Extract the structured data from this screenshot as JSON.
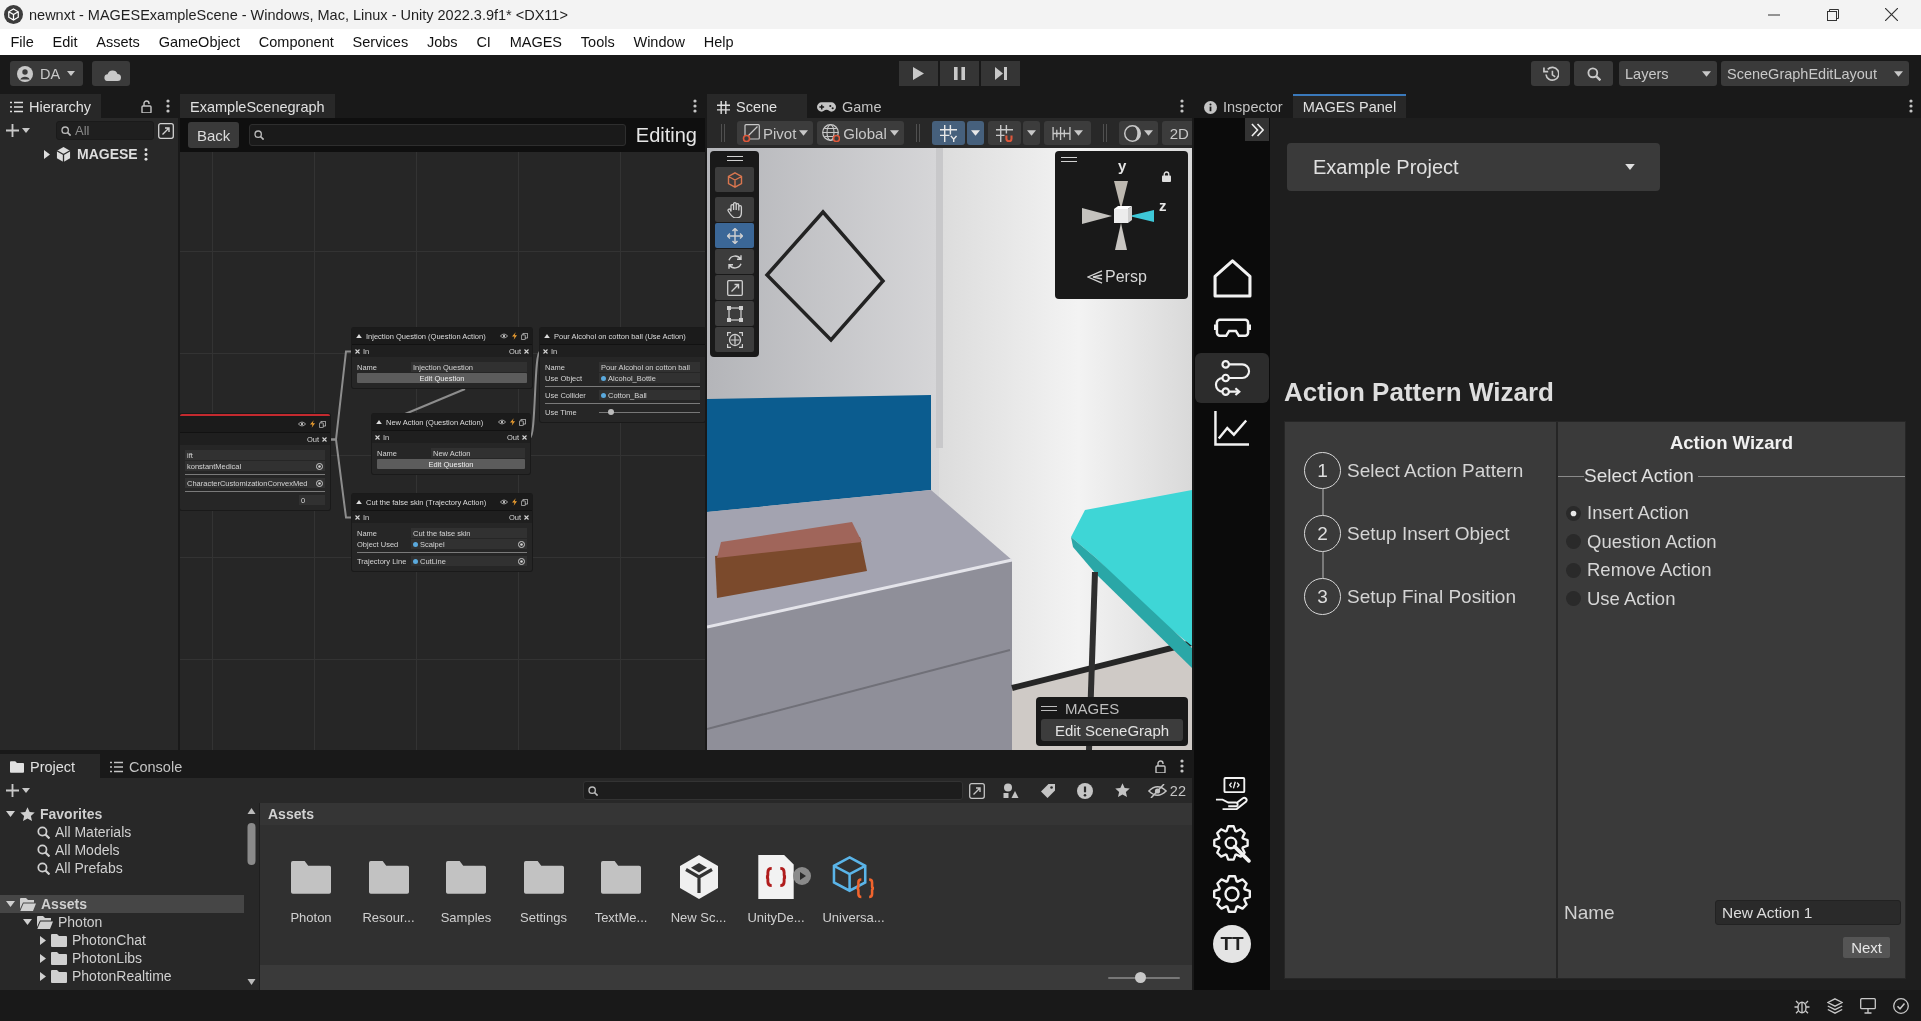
{
  "window": {
    "title": "newnxt - MAGESExampleScene - Windows, Mac, Linux - Unity 2022.3.9f1* <DX11>"
  },
  "menu": [
    "File",
    "Edit",
    "Assets",
    "GameObject",
    "Component",
    "Services",
    "Jobs",
    "CI",
    "MAGES",
    "Tools",
    "Window",
    "Help"
  ],
  "toolbar": {
    "account": "DA",
    "layers": "Layers",
    "layout": "SceneGraphEditLayout"
  },
  "hierarchy": {
    "tab": "Hierarchy",
    "search": {
      "placeholder": "All"
    },
    "items": [
      {
        "label": "MAGESE",
        "expanded": false
      }
    ]
  },
  "graph": {
    "tab": "ExampleScenegraph",
    "back": "Back",
    "status": "Editing",
    "nodes": [
      {
        "title": "Injection Question (Question Action)",
        "active": false,
        "in": "In",
        "out": "Out",
        "fields": [
          {
            "kind": "text",
            "label": "Name",
            "value": "Injection Question"
          },
          {
            "kind": "button",
            "label": "Edit Question"
          }
        ]
      },
      {
        "title": "Pour Alcohol on cotton ball (Use Action)",
        "active": false,
        "in": "In",
        "fields": [
          {
            "kind": "text",
            "label": "Name",
            "value": "Pour Alcohol on cotton ball"
          },
          {
            "kind": "object",
            "label": "Use Object",
            "value": "Alcohol_Bottle"
          },
          {
            "kind": "object",
            "label": "Use Collider",
            "value": "Cotton_Ball"
          },
          {
            "kind": "slider",
            "label": "Use Time",
            "level": 0.12
          }
        ]
      },
      {
        "title": "New Action (Question Action)",
        "active": false,
        "in": "In",
        "out": "Out",
        "fields": [
          {
            "kind": "text",
            "label": "Name",
            "value": "New Action"
          },
          {
            "kind": "button",
            "label": "Edit Question"
          }
        ]
      },
      {
        "title": "Cut the false skin (Trajectory Action)",
        "active": false,
        "in": "In",
        "out": "Out",
        "fields": [
          {
            "kind": "text",
            "label": "Name",
            "value": "Cut the false skin"
          },
          {
            "kind": "object",
            "label": "Object Used",
            "value": "Scalpel"
          },
          {
            "kind": "object",
            "label": "Trajectory Line",
            "value": "CutLine"
          }
        ]
      },
      {
        "active": true,
        "out": "Out",
        "fields": [
          {
            "kind": "text",
            "value": "ift"
          },
          {
            "kind": "object",
            "value": "konstantMedical"
          },
          {
            "kind": "object",
            "value": "CharacterCustomizationConvexMed"
          },
          {
            "kind": "number",
            "value": "0"
          }
        ]
      }
    ]
  },
  "scene": {
    "tabs": [
      {
        "label": "Scene",
        "selected": true
      },
      {
        "label": "Game",
        "selected": false
      }
    ],
    "pivot": "Pivot",
    "space": "Global",
    "view_2d": "2D",
    "toggles": [
      {
        "on": true
      },
      {
        "on": false
      },
      {
        "on": false
      }
    ],
    "tools": [
      {
        "selected": false
      },
      {
        "selected": false
      },
      {
        "selected": true
      },
      {
        "selected": false
      },
      {
        "selected": false
      },
      {
        "selected": false
      },
      {
        "selected": false
      }
    ],
    "gizmo": {
      "axes": [
        "y",
        "z"
      ],
      "projection": "Persp"
    },
    "overlay": {
      "title": "MAGES",
      "button": "Edit SceneGraph"
    }
  },
  "inspector": {
    "tabs": [
      {
        "label": "Inspector",
        "selected": false
      },
      {
        "label": "MAGES Panel",
        "selected": true
      }
    ],
    "nav": [
      {
        "selected": false
      },
      {
        "selected": false
      },
      {
        "selected": true
      },
      {
        "selected": false
      },
      {
        "selected": false
      },
      {
        "selected": false
      },
      {
        "selected": false
      }
    ],
    "avatar": "TT",
    "project": "Example Project",
    "heading": "Action Pattern Wizard",
    "wizard": {
      "steps": [
        {
          "number": "1",
          "label": "Select Action Pattern"
        },
        {
          "number": "2",
          "label": "Setup Insert Object"
        },
        {
          "number": "3",
          "label": "Setup Final Position"
        }
      ],
      "title": "Action Wizard",
      "group": "Select Action",
      "options": [
        {
          "label": "Insert Action",
          "selected": true
        },
        {
          "label": "Question Action",
          "selected": false
        },
        {
          "label": "Remove Action",
          "selected": false
        },
        {
          "label": "Use Action",
          "selected": false
        }
      ],
      "name_field": {
        "label": "Name",
        "value": "New Action 1"
      },
      "next": "Next"
    }
  },
  "project": {
    "tabs": [
      {
        "label": "Project",
        "selected": true
      },
      {
        "label": "Console",
        "selected": false
      }
    ],
    "hidden_count": "22",
    "tree": [
      {
        "label": "Favorites",
        "kind": "favorites",
        "expanded": true,
        "selected": false,
        "children": [
          {
            "label": "All Materials",
            "kind": "search",
            "selected": false
          },
          {
            "label": "All Models",
            "kind": "search",
            "selected": false
          },
          {
            "label": "All Prefabs",
            "kind": "search",
            "selected": false
          }
        ]
      },
      {
        "label": "Assets",
        "kind": "folder",
        "expanded": true,
        "selected": true,
        "children": [
          {
            "label": "Photon",
            "kind": "folder",
            "expanded": true,
            "selected": false,
            "children": [
              {
                "label": "PhotonChat",
                "kind": "folder",
                "expanded": false,
                "selected": false
              },
              {
                "label": "PhotonLibs",
                "kind": "folder",
                "expanded": false,
                "selected": false
              },
              {
                "label": "PhotonRealtime",
                "kind": "folder",
                "expanded": false,
                "selected": false
              }
            ]
          }
        ]
      }
    ],
    "path": "Assets",
    "assets": [
      {
        "label": "Photon",
        "kind": "folder"
      },
      {
        "label": "Resour...",
        "kind": "folder"
      },
      {
        "label": "Samples",
        "kind": "folder"
      },
      {
        "label": "Settings",
        "kind": "folder"
      },
      {
        "label": "TextMe...",
        "kind": "folder"
      },
      {
        "label": "New Sc...",
        "kind": "scene"
      },
      {
        "label": "UnityDe...",
        "kind": "script"
      },
      {
        "label": "Universa...",
        "kind": "package"
      }
    ],
    "zoom": {
      "level": 0.45
    }
  }
}
